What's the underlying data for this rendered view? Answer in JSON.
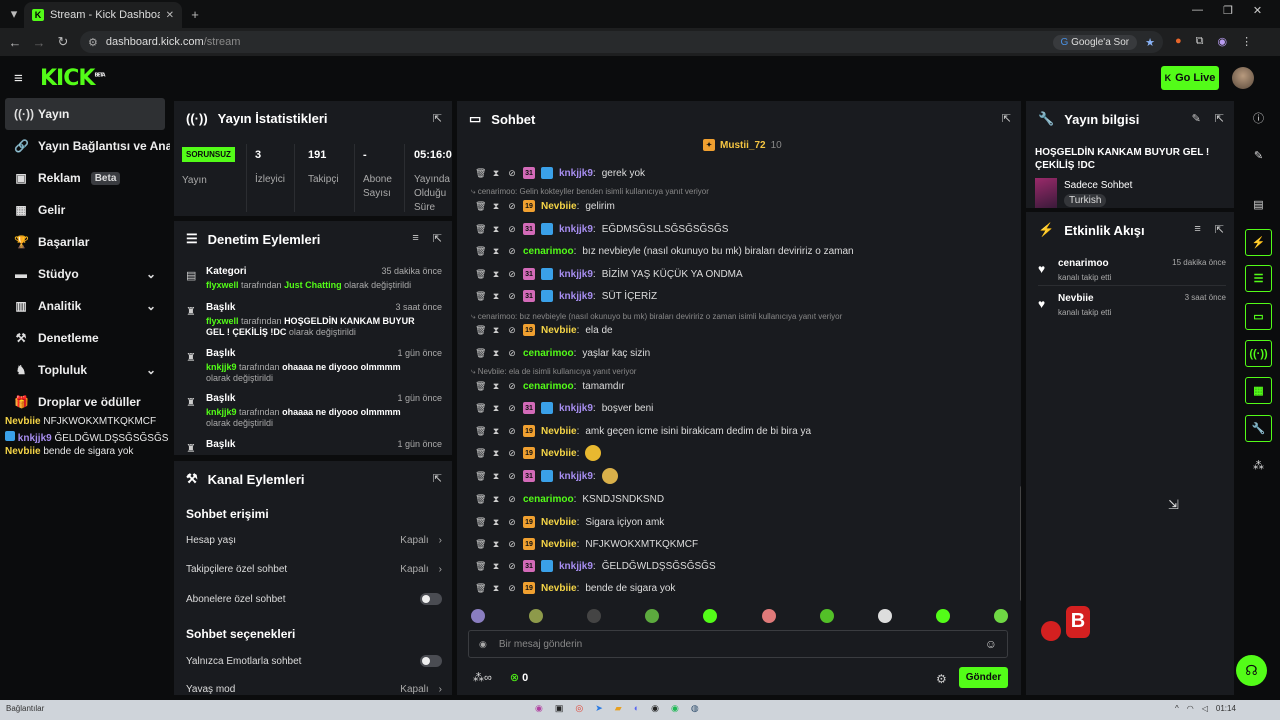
{
  "browser": {
    "tab_title": "Stream - Kick Dashboard",
    "url_host": "dashboard.kick.com",
    "url_path": "/stream",
    "google_btn": "Google'a Sor"
  },
  "header": {
    "logo": "KICK",
    "logo_sup": "BETA",
    "go_live": "Go Live"
  },
  "sidebar": {
    "items": [
      {
        "label": "Yayın",
        "icon": "broadcast-icon"
      },
      {
        "label": "Yayın Bağlantısı ve Anahtarı",
        "icon": "link-icon"
      },
      {
        "label": "Reklam",
        "badge": "Beta",
        "icon": "ad-icon"
      },
      {
        "label": "Gelir",
        "icon": "revenue-icon"
      },
      {
        "label": "Başarılar",
        "icon": "trophy-icon"
      },
      {
        "label": "Stüdyo",
        "icon": "studio-icon"
      },
      {
        "label": "Analitik",
        "icon": "analytics-icon"
      },
      {
        "label": "Denetleme",
        "icon": "moderation-icon"
      },
      {
        "label": "Topluluk",
        "icon": "community-icon"
      },
      {
        "label": "Droplar ve ödüller",
        "icon": "drops-icon"
      }
    ],
    "overlay": [
      {
        "user": "Nevbiie",
        "text": "NFJKWOKXMTKQKMCF"
      },
      {
        "user": "knkjjk9",
        "text": "ĞELDĞWLDŞSĞSĞSĞS"
      },
      {
        "user": "Nevbiie",
        "text": "bende de sigara yok"
      }
    ]
  },
  "stats": {
    "title": "Yayın İstatistikleri",
    "status": "SORUNSUZ",
    "status_label": "Yayın",
    "viewers": "3",
    "viewers_label": "İzleyici",
    "followers": "191",
    "followers_label": "Takipçi",
    "subs": "-",
    "subs_label": "Abone Sayısı",
    "duration": "05:16:00",
    "duration_label": "Yayında Olduğu Süre"
  },
  "moderation": {
    "title": "Denetim Eylemleri",
    "items": [
      {
        "head": "Kategori",
        "time": "35 dakika önce",
        "user": "flyxwell",
        "mid": " tarafından ",
        "value": "Just Chatting",
        "tail": " olarak değiştirildi"
      },
      {
        "head": "Başlık",
        "time": "3 saat önce",
        "user": "flyxwell",
        "mid": " tarafından ",
        "value": "HOŞGELDİN KANKAM BUYUR GEL ! ÇEKİLİŞ !DC",
        "tail": " olarak değiştirildi"
      },
      {
        "head": "Başlık",
        "time": "1 gün önce",
        "user": "knkjjk9",
        "mid": " tarafından ",
        "value": "ohaaaa ne diyooo olmmmm",
        "tail": " olarak değiştirildi"
      },
      {
        "head": "Başlık",
        "time": "1 gün önce",
        "user": "knkjjk9",
        "mid": " tarafından ",
        "value": "ohaaaa ne diyooo olmmmm",
        "tail": " olarak değiştirildi"
      },
      {
        "head": "Başlık",
        "time": "1 gün önce",
        "user": "",
        "mid": "",
        "value": "",
        "tail": ""
      }
    ]
  },
  "channel": {
    "title": "Kanal Eylemleri",
    "chat_access": "Sohbet erişimi",
    "account_age": "Hesap yaşı",
    "account_age_val": "Kapalı",
    "followers_only": "Takipçilere özel sohbet",
    "followers_only_val": "Kapalı",
    "subs_only": "Abonelere özel sohbet",
    "chat_options": "Sohbet seçenekleri",
    "emote_only": "Yalnızca Emotlarla sohbet",
    "slow_mode": "Yavaş mod",
    "slow_mode_val": "Kapalı"
  },
  "chat": {
    "title": "Sohbet",
    "pinned_user": "Mustii_72",
    "pinned_count": "10",
    "placeholder": "Bir mesaj gönderin",
    "send": "Gönder",
    "count": "0",
    "messages": [
      {
        "type": "msg",
        "user": "knkjjk9",
        "color": "purple",
        "badges": [
          "pink",
          "blue"
        ],
        "text": "gerek yok"
      },
      {
        "type": "reply",
        "text": "cenarimoo: Gelin kokteyller benden isimli kullanıcıya yanıt veriyor"
      },
      {
        "type": "msg",
        "user": "Nevbiie",
        "color": "yellow",
        "badges": [
          "sub"
        ],
        "text": "gelirim"
      },
      {
        "type": "msg",
        "user": "knkjjk9",
        "color": "purple",
        "badges": [
          "pink",
          "blue"
        ],
        "text": "EĞDMSĞSLLSĞSĞSĞSĞS"
      },
      {
        "type": "msg",
        "user": "cenarimoo",
        "color": "green",
        "badges": [],
        "text": "bız nevbieyle (nasıl okunuyo bu mk) biraları deviririz o zaman"
      },
      {
        "type": "msg",
        "user": "knkjjk9",
        "color": "purple",
        "badges": [
          "pink",
          "blue"
        ],
        "text": "BİZİM YAŞ KÜÇÜK YA ONDMA"
      },
      {
        "type": "msg",
        "user": "knkjjk9",
        "color": "purple",
        "badges": [
          "pink",
          "blue"
        ],
        "text": "SÜT İÇERİZ"
      },
      {
        "type": "reply",
        "text": "cenarimoo: bız nevbieyle (nasıl okunuyo bu mk) biraları deviririz o zaman isimli kullanıcıya yanıt veriyor"
      },
      {
        "type": "msg",
        "user": "Nevbiie",
        "color": "yellow",
        "badges": [
          "sub"
        ],
        "text": "ela de"
      },
      {
        "type": "msg",
        "user": "cenarimoo",
        "color": "green",
        "badges": [],
        "text": "yaşlar kaç sizin"
      },
      {
        "type": "reply",
        "text": "Nevbiie: ela de isimli kullanıcıya yanıt veriyor"
      },
      {
        "type": "msg",
        "user": "cenarimoo",
        "color": "green",
        "badges": [],
        "text": "tamamdır"
      },
      {
        "type": "msg",
        "user": "knkjjk9",
        "color": "purple",
        "badges": [
          "pink",
          "blue"
        ],
        "text": "boşver beni"
      },
      {
        "type": "msg",
        "user": "Nevbiie",
        "color": "yellow",
        "badges": [
          "sub"
        ],
        "text": "amk geçen icme isini birakicam dedim de bi bira ya"
      },
      {
        "type": "msg",
        "user": "Nevbiie",
        "color": "yellow",
        "badges": [
          "sub"
        ],
        "text": "",
        "emote": "#e8b830"
      },
      {
        "type": "msg",
        "user": "knkjjk9",
        "color": "purple",
        "badges": [
          "pink",
          "blue"
        ],
        "text": "",
        "emote": "#d9b04a"
      },
      {
        "type": "msg",
        "user": "cenarimoo",
        "color": "green",
        "badges": [],
        "text": "KSNDJSNDKSND"
      },
      {
        "type": "msg",
        "user": "Nevbiie",
        "color": "yellow",
        "badges": [
          "sub"
        ],
        "text": "Sigara içiyon amk"
      },
      {
        "type": "msg",
        "user": "Nevbiie",
        "color": "yellow",
        "badges": [
          "sub"
        ],
        "text": "NFJKWOKXMTKQKMCF"
      },
      {
        "type": "msg",
        "user": "knkjjk9",
        "color": "purple",
        "badges": [
          "pink",
          "blue"
        ],
        "text": "ĞELDĞWLDŞSĞSĞSĞS"
      },
      {
        "type": "msg",
        "user": "Nevbiie",
        "color": "yellow",
        "badges": [
          "sub"
        ],
        "text": "bende de sigara yok"
      }
    ]
  },
  "info": {
    "title": "Yayın bilgisi",
    "stream_title": "HOŞGELDİN KANKAM BUYUR GEL ! ÇEKİLİŞ !DC",
    "category": "Sadece Sohbet",
    "language": "Turkish"
  },
  "activity": {
    "title": "Etkinlik Akışı",
    "items": [
      {
        "name": "cenarimoo",
        "sub": "kanalı takip etti",
        "time": "15 dakika önce"
      },
      {
        "name": "Nevbiie",
        "sub": "kanalı takip etti",
        "time": "3 saat önce"
      }
    ]
  },
  "taskbar": {
    "left": "Bağlantılar",
    "time": "01:14"
  },
  "colors": {
    "accent": "#53fc18",
    "panel": "#191b1f",
    "bg": "#0b0c0d"
  }
}
